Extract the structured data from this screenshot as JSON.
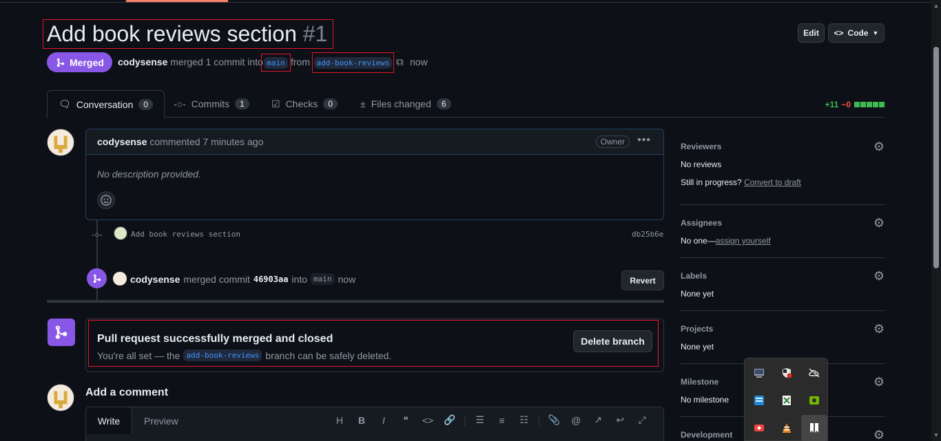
{
  "header": {
    "title": "Add book reviews section",
    "number": "#1",
    "edit_label": "Edit",
    "code_label": "Code"
  },
  "status": {
    "state_label": "Merged",
    "author": "codysense",
    "merged_text": "merged 1 commit into",
    "base_branch": "main",
    "from_text": "from",
    "head_branch": "add-book-reviews",
    "time": "now"
  },
  "tabs": [
    {
      "label": "Conversation",
      "count": "0"
    },
    {
      "label": "Commits",
      "count": "1"
    },
    {
      "label": "Checks",
      "count": "0"
    },
    {
      "label": "Files changed",
      "count": "6"
    }
  ],
  "diffstat": {
    "additions": "+11",
    "deletions": "−0"
  },
  "comment": {
    "author": "codysense",
    "time_text": "commented 7 minutes ago",
    "role": "Owner",
    "body": "No description provided."
  },
  "commit": {
    "message": "Add book reviews section",
    "sha": "db25b6e"
  },
  "merge_event": {
    "author": "codysense",
    "text": "merged commit",
    "commit": "46903aa",
    "into_text": "into",
    "branch": "main",
    "time": "now",
    "revert_label": "Revert"
  },
  "merge_box": {
    "title": "Pull request successfully merged and closed",
    "desc_before": "You're all set — the",
    "branch": "add-book-reviews",
    "desc_after": "branch can be safely deleted.",
    "delete_label": "Delete branch"
  },
  "add_comment": {
    "heading": "Add a comment",
    "write_tab": "Write",
    "preview_tab": "Preview",
    "heading_tool": "H",
    "bold_tool": "B",
    "italic_tool": "I"
  },
  "sidebar": {
    "reviewers": {
      "heading": "Reviewers",
      "value": "No reviews",
      "progress_text": "Still in progress?",
      "progress_link": "Convert to draft"
    },
    "assignees": {
      "heading": "Assignees",
      "value": "No one—",
      "link": "assign yourself"
    },
    "labels": {
      "heading": "Labels",
      "value": "None yet"
    },
    "projects": {
      "heading": "Projects",
      "value": "None yet"
    },
    "milestone": {
      "heading": "Milestone",
      "value": "No milestone"
    },
    "development": {
      "heading": "Development"
    }
  },
  "colors": {
    "merged_purple": "#8957e5",
    "accent_red_box": "#e5162b",
    "link_blue": "#4493f8",
    "add_green": "#3fb950",
    "del_red": "#f85149"
  },
  "tray_icons": [
    "monitor-icon",
    "shield-x-icon",
    "cloud-off-icon",
    "app-blue-icon",
    "notepad-icon",
    "nvidia-icon",
    "anydesk-icon",
    "vlc-icon",
    "bookmark-icon"
  ]
}
